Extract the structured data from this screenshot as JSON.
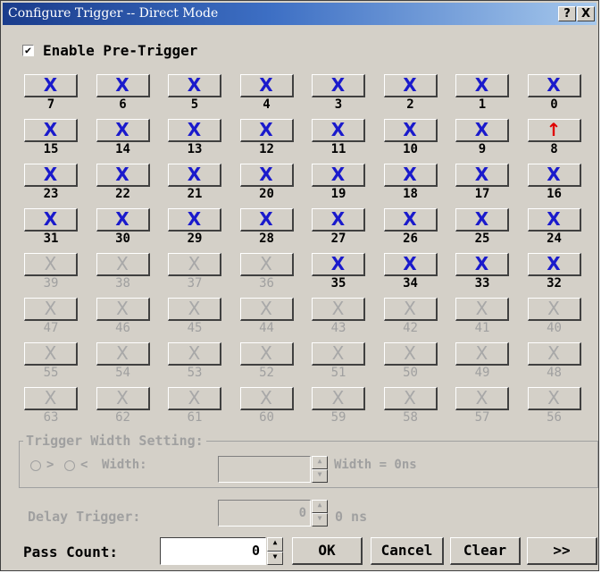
{
  "window": {
    "title": "Configure Trigger -- Direct Mode",
    "help_label": "?",
    "close_label": "X"
  },
  "pretrigger": {
    "checked_mark": "✔",
    "label": "Enable Pre-Trigger"
  },
  "channels": [
    {
      "label": "7",
      "state": "X",
      "enabled": true
    },
    {
      "label": "6",
      "state": "X",
      "enabled": true
    },
    {
      "label": "5",
      "state": "X",
      "enabled": true
    },
    {
      "label": "4",
      "state": "X",
      "enabled": true
    },
    {
      "label": "3",
      "state": "X",
      "enabled": true
    },
    {
      "label": "2",
      "state": "X",
      "enabled": true
    },
    {
      "label": "1",
      "state": "X",
      "enabled": true
    },
    {
      "label": "0",
      "state": "X",
      "enabled": true
    },
    {
      "label": "15",
      "state": "X",
      "enabled": true
    },
    {
      "label": "14",
      "state": "X",
      "enabled": true
    },
    {
      "label": "13",
      "state": "X",
      "enabled": true
    },
    {
      "label": "12",
      "state": "X",
      "enabled": true
    },
    {
      "label": "11",
      "state": "X",
      "enabled": true
    },
    {
      "label": "10",
      "state": "X",
      "enabled": true
    },
    {
      "label": "9",
      "state": "X",
      "enabled": true
    },
    {
      "label": "8",
      "state": "↑",
      "enabled": true
    },
    {
      "label": "23",
      "state": "X",
      "enabled": true
    },
    {
      "label": "22",
      "state": "X",
      "enabled": true
    },
    {
      "label": "21",
      "state": "X",
      "enabled": true
    },
    {
      "label": "20",
      "state": "X",
      "enabled": true
    },
    {
      "label": "19",
      "state": "X",
      "enabled": true
    },
    {
      "label": "18",
      "state": "X",
      "enabled": true
    },
    {
      "label": "17",
      "state": "X",
      "enabled": true
    },
    {
      "label": "16",
      "state": "X",
      "enabled": true
    },
    {
      "label": "31",
      "state": "X",
      "enabled": true
    },
    {
      "label": "30",
      "state": "X",
      "enabled": true
    },
    {
      "label": "29",
      "state": "X",
      "enabled": true
    },
    {
      "label": "28",
      "state": "X",
      "enabled": true
    },
    {
      "label": "27",
      "state": "X",
      "enabled": true
    },
    {
      "label": "26",
      "state": "X",
      "enabled": true
    },
    {
      "label": "25",
      "state": "X",
      "enabled": true
    },
    {
      "label": "24",
      "state": "X",
      "enabled": true
    },
    {
      "label": "39",
      "state": "X",
      "enabled": false
    },
    {
      "label": "38",
      "state": "X",
      "enabled": false
    },
    {
      "label": "37",
      "state": "X",
      "enabled": false
    },
    {
      "label": "36",
      "state": "X",
      "enabled": false
    },
    {
      "label": "35",
      "state": "X",
      "enabled": true
    },
    {
      "label": "34",
      "state": "X",
      "enabled": true
    },
    {
      "label": "33",
      "state": "X",
      "enabled": true
    },
    {
      "label": "32",
      "state": "X",
      "enabled": true
    },
    {
      "label": "47",
      "state": "X",
      "enabled": false
    },
    {
      "label": "46",
      "state": "X",
      "enabled": false
    },
    {
      "label": "45",
      "state": "X",
      "enabled": false
    },
    {
      "label": "44",
      "state": "X",
      "enabled": false
    },
    {
      "label": "43",
      "state": "X",
      "enabled": false
    },
    {
      "label": "42",
      "state": "X",
      "enabled": false
    },
    {
      "label": "41",
      "state": "X",
      "enabled": false
    },
    {
      "label": "40",
      "state": "X",
      "enabled": false
    },
    {
      "label": "55",
      "state": "X",
      "enabled": false
    },
    {
      "label": "54",
      "state": "X",
      "enabled": false
    },
    {
      "label": "53",
      "state": "X",
      "enabled": false
    },
    {
      "label": "52",
      "state": "X",
      "enabled": false
    },
    {
      "label": "51",
      "state": "X",
      "enabled": false
    },
    {
      "label": "50",
      "state": "X",
      "enabled": false
    },
    {
      "label": "49",
      "state": "X",
      "enabled": false
    },
    {
      "label": "48",
      "state": "X",
      "enabled": false
    },
    {
      "label": "63",
      "state": "X",
      "enabled": false
    },
    {
      "label": "62",
      "state": "X",
      "enabled": false
    },
    {
      "label": "61",
      "state": "X",
      "enabled": false
    },
    {
      "label": "60",
      "state": "X",
      "enabled": false
    },
    {
      "label": "59",
      "state": "X",
      "enabled": false
    },
    {
      "label": "58",
      "state": "X",
      "enabled": false
    },
    {
      "label": "57",
      "state": "X",
      "enabled": false
    },
    {
      "label": "56",
      "state": "X",
      "enabled": false
    }
  ],
  "trigger_width": {
    "title": "Trigger Width Setting:",
    "greater_label": ">",
    "less_label": "<",
    "width_label": "Width:",
    "width_value": "",
    "width_result": "Width = 0ns"
  },
  "delay": {
    "label": "Delay Trigger:",
    "value": "0",
    "unit": "0 ns"
  },
  "pass_count": {
    "label": "Pass Count:",
    "value": "0"
  },
  "buttons": {
    "ok": "OK",
    "cancel": "Cancel",
    "clear": "Clear",
    "more": ">>"
  },
  "colors": {
    "active_x": "#1a1acc",
    "rising_edge": "#e00000",
    "disabled": "#a0a0a0",
    "face": "#d4d0c8"
  },
  "icons": {
    "spin_up": "up-arrow-icon",
    "spin_down": "down-arrow-icon"
  }
}
